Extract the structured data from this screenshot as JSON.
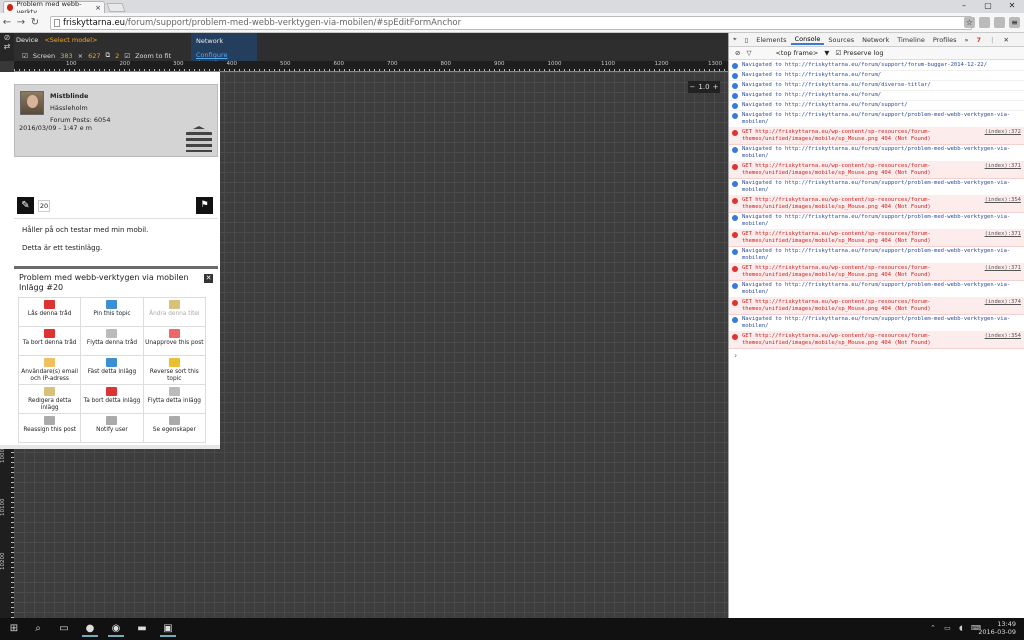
{
  "browser": {
    "tab_title": "Problem med webb-verkty",
    "close_tab": "×",
    "url_host": "friskyttarna.eu",
    "url_path": "/forum/support/problem-med-webb-verktygen-via-mobilen/#spEditFormAnchor",
    "win_min": "–",
    "win_max": "▢",
    "win_close": "✕"
  },
  "emulation": {
    "device_label": "Device",
    "model_select": "<Select model>",
    "screen_label": "Screen",
    "screen_w": "383",
    "screen_h": "627",
    "dpr": "2",
    "zoom_to_fit": "Zoom to fit",
    "network_label": "Network",
    "throttle_link": "Configure throttling",
    "zoom_value": "1.0",
    "zoom_minus": "−",
    "zoom_plus": "+",
    "h_ruler": [
      "100",
      "200",
      "300",
      "400",
      "500",
      "600",
      "700",
      "800",
      "900",
      "1000",
      "1100",
      "1200",
      "1300"
    ],
    "v_ruler": [
      "9300",
      "9400",
      "9500",
      "9600",
      "9700",
      "9800",
      "9900",
      "10000",
      "10100",
      "10200"
    ]
  },
  "post": {
    "author": "Mistblinde",
    "location": "Hässleholm",
    "posts": "Forum Posts: 6054",
    "date": "2016/03/09 - 1:47 e m",
    "count": "20",
    "line1": "Håller på och testar med min mobil.",
    "line2": "Detta är ett testinlägg."
  },
  "modal": {
    "title": "Problem med webb-verktygen via mobilen Inlägg #20",
    "close": "✕",
    "actions": [
      {
        "label": "Lås denna tråd",
        "icon": "lock-icon",
        "cls": "i-lock",
        "dim": false
      },
      {
        "label": "Pin this topic",
        "icon": "pin-icon",
        "cls": "i-pin",
        "dim": false
      },
      {
        "label": "Ändra denna titel",
        "icon": "edit-title-icon",
        "cls": "i-edit",
        "dim": true
      },
      {
        "label": "Ta bort denna tråd",
        "icon": "delete-topic-icon",
        "cls": "i-del",
        "dim": false
      },
      {
        "label": "Flytta denna tråd",
        "icon": "move-topic-icon",
        "cls": "i-move",
        "dim": false
      },
      {
        "label": "Unapprove this post",
        "icon": "unapprove-icon",
        "cls": "i-x",
        "dim": false
      },
      {
        "label": "Användare(s) email och IP-adress",
        "icon": "email-icon",
        "cls": "i-mail",
        "dim": false
      },
      {
        "label": "Fäst detta inlägg",
        "icon": "pin-post-icon",
        "cls": "i-fast",
        "dim": false
      },
      {
        "label": "Reverse sort this topic",
        "icon": "reverse-sort-icon",
        "cls": "i-rev",
        "dim": false
      },
      {
        "label": "Redigera detta inlägg",
        "icon": "edit-post-icon",
        "cls": "i-redit",
        "dim": false
      },
      {
        "label": "Ta bort detta inlägg",
        "icon": "delete-post-icon",
        "cls": "i-del",
        "dim": false
      },
      {
        "label": "Flytta detta inlägg",
        "icon": "move-post-icon",
        "cls": "i-move",
        "dim": false
      },
      {
        "label": "Reassign this post",
        "icon": "reassign-icon",
        "cls": "i-gray",
        "dim": false
      },
      {
        "label": "Notify user",
        "icon": "notify-icon",
        "cls": "i-gray",
        "dim": false
      },
      {
        "label": "Se egenskaper",
        "icon": "properties-icon",
        "cls": "i-gray",
        "dim": false
      }
    ]
  },
  "devtools": {
    "tabs": [
      "Elements",
      "Console",
      "Sources",
      "Network",
      "Timeline",
      "Profiles",
      "»"
    ],
    "error_count": "7",
    "context": "<top frame>",
    "preserve": "Preserve log",
    "log": [
      {
        "t": "info",
        "text": "Navigated to http://friskyttarna.eu/forum/support/forum-buggar-2014-12-22/"
      },
      {
        "t": "info",
        "text": "Navigated to http://friskyttarna.eu/forum/"
      },
      {
        "t": "info",
        "text": "Navigated to http://friskyttarna.eu/forum/diverse-titlar/"
      },
      {
        "t": "info",
        "text": "Navigated to http://friskyttarna.eu/forum/"
      },
      {
        "t": "info",
        "text": "Navigated to http://friskyttarna.eu/forum/support/"
      },
      {
        "t": "info",
        "text": "Navigated to http://friskyttarna.eu/forum/support/problem-med-webb-verktygen-via-mobilen/"
      },
      {
        "t": "err",
        "text": "GET http://friskyttarna.eu/wp-content/sp-resources/forum-themes/unified/images/mobile/sp_Mouse.png 404 (Not Found)",
        "src": "(index):372"
      },
      {
        "t": "info",
        "text": "Navigated to http://friskyttarna.eu/forum/support/problem-med-webb-verktygen-via-mobilen/"
      },
      {
        "t": "err",
        "text": "GET http://friskyttarna.eu/wp-content/sp-resources/forum-themes/unified/images/mobile/sp_Mouse.png 404 (Not Found)",
        "src": "(index):371"
      },
      {
        "t": "info",
        "text": "Navigated to http://friskyttarna.eu/forum/support/problem-med-webb-verktygen-via-mobilen/"
      },
      {
        "t": "err",
        "text": "GET http://friskyttarna.eu/wp-content/sp-resources/forum-themes/unified/images/mobile/sp_Mouse.png 404 (Not Found)",
        "src": "(index):354"
      },
      {
        "t": "info",
        "text": "Navigated to http://friskyttarna.eu/forum/support/problem-med-webb-verktygen-via-mobilen/"
      },
      {
        "t": "err",
        "text": "GET http://friskyttarna.eu/wp-content/sp-resources/forum-themes/unified/images/mobile/sp_Mouse.png 404 (Not Found)",
        "src": "(index):371"
      },
      {
        "t": "info",
        "text": "Navigated to http://friskyttarna.eu/forum/support/problem-med-webb-verktygen-via-mobilen/"
      },
      {
        "t": "err",
        "text": "GET http://friskyttarna.eu/wp-content/sp-resources/forum-themes/unified/images/mobile/sp_Mouse.png 404 (Not Found)",
        "src": "(index):371"
      },
      {
        "t": "info",
        "text": "Navigated to http://friskyttarna.eu/forum/support/problem-med-webb-verktygen-via-mobilen/"
      },
      {
        "t": "err",
        "text": "GET http://friskyttarna.eu/wp-content/sp-resources/forum-themes/unified/images/mobile/sp_Mouse.png 404 (Not Found)",
        "src": "(index):374"
      },
      {
        "t": "info",
        "text": "Navigated to http://friskyttarna.eu/forum/support/problem-med-webb-verktygen-via-mobilen/"
      },
      {
        "t": "err",
        "text": "GET http://friskyttarna.eu/wp-content/sp-resources/forum-themes/unified/images/mobile/sp_Mouse.png 404 (Not Found)",
        "src": "(index):354"
      }
    ],
    "prompt": "›"
  },
  "taskbar": {
    "time": "13:49",
    "date": "2016-03-09"
  }
}
